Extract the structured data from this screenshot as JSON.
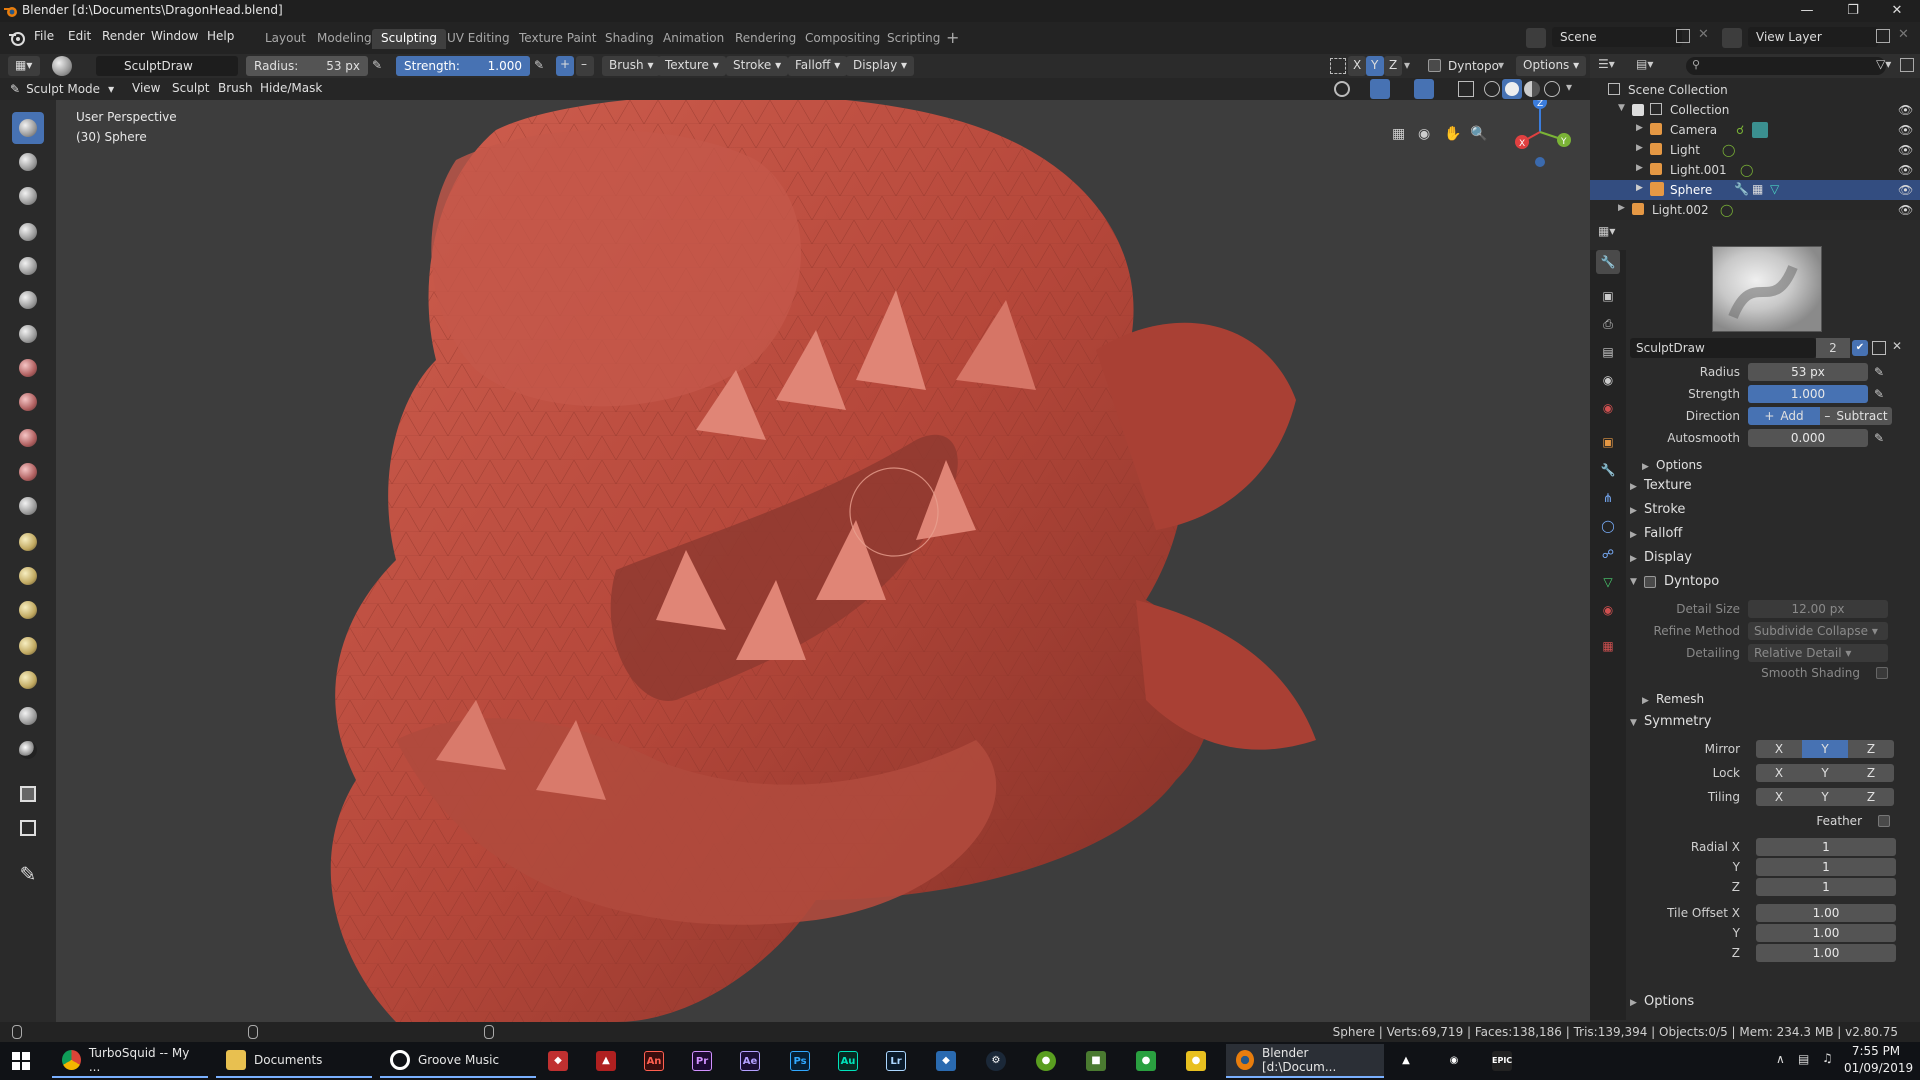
{
  "window": {
    "title": "Blender [d:\\Documents\\DragonHead.blend]"
  },
  "menu": [
    "File",
    "Edit",
    "Render",
    "Window",
    "Help"
  ],
  "workspaces": [
    "Layout",
    "Modeling",
    "Sculpting",
    "UV Editing",
    "Texture Paint",
    "Shading",
    "Animation",
    "Rendering",
    "Compositing",
    "Scripting"
  ],
  "active_workspace": "Sculpting",
  "top_right": {
    "scene": "Scene",
    "view_layer": "View Layer"
  },
  "tool_header": {
    "brush_name": "SculptDraw",
    "radius_label": "Radius:",
    "radius_value": "53 px",
    "strength_label": "Strength:",
    "strength_value": "1.000",
    "strength_fill": 1.0,
    "menus": [
      "Brush",
      "Texture",
      "Stroke",
      "Falloff",
      "Display"
    ],
    "axes": [
      "X",
      "Y",
      "Z"
    ],
    "dyntopo": "Dyntopo",
    "options": "Options"
  },
  "mode_header": {
    "mode": "Sculpt Mode",
    "menus": [
      "View",
      "Sculpt",
      "Brush",
      "Hide/Mask"
    ]
  },
  "viewport": {
    "perspective": "User Perspective",
    "object": "(30) Sphere",
    "gizmo": {
      "x": "X",
      "y": "Y",
      "z": "Z"
    }
  },
  "outliner": {
    "root": "Scene Collection",
    "items": [
      {
        "name": "Collection",
        "indent": 1
      },
      {
        "name": "Camera",
        "indent": 2
      },
      {
        "name": "Light",
        "indent": 2
      },
      {
        "name": "Light.001",
        "indent": 2
      },
      {
        "name": "Sphere",
        "indent": 2,
        "selected": true
      },
      {
        "name": "Light.002",
        "indent": 1
      }
    ]
  },
  "properties": {
    "brush_name": "SculptDraw",
    "brush_users": "2",
    "radius": {
      "label": "Radius",
      "value": "53 px"
    },
    "strength": {
      "label": "Strength",
      "value": "1.000"
    },
    "direction": {
      "label": "Direction",
      "add": "Add",
      "subtract": "Subtract"
    },
    "autosmooth": {
      "label": "Autosmooth",
      "value": "0.000"
    },
    "options_sub": "Options",
    "sections": [
      "Texture",
      "Stroke",
      "Falloff",
      "Display"
    ],
    "dyntopo": {
      "label": "Dyntopo",
      "detail_size": {
        "label": "Detail Size",
        "value": "12.00 px"
      },
      "refine_method": {
        "label": "Refine Method",
        "value": "Subdivide Collapse"
      },
      "detailing": {
        "label": "Detailing",
        "value": "Relative Detail"
      },
      "smooth_shading": "Smooth Shading"
    },
    "remesh": "Remesh",
    "symmetry": {
      "label": "Symmetry",
      "mirror": "Mirror",
      "lock": "Lock",
      "tiling": "Tiling",
      "axes": [
        "X",
        "Y",
        "Z"
      ],
      "feather": "Feather",
      "radial_x": {
        "label": "Radial X",
        "value": "1"
      },
      "radial_y": {
        "label": "Y",
        "value": "1"
      },
      "radial_z": {
        "label": "Z",
        "value": "1"
      },
      "tile_x": {
        "label": "Tile Offset X",
        "value": "1.00"
      },
      "tile_y": {
        "label": "Y",
        "value": "1.00"
      },
      "tile_z": {
        "label": "Z",
        "value": "1.00"
      }
    },
    "options_bottom": "Options"
  },
  "status": "Sphere | Verts:69,719 | Faces:138,186 | Tris:139,394 | Objects:0/5 | Mem: 234.3 MB | v2.80.75",
  "taskbar": {
    "chrome": "TurboSquid -- My ...",
    "documents": "Documents",
    "groove": "Groove Music",
    "blender": "Blender [d:\\Docum...",
    "apps": [
      "An",
      "Pr",
      "Ae",
      "Ps",
      "Au",
      "Lr"
    ],
    "time": "7:55 PM",
    "date": "01/09/2019",
    "epic": "EPIC"
  },
  "colors": {
    "accent": "#4772b3",
    "selection": "#334d80",
    "mesh": "#b5473a",
    "background": "#3d3d3d"
  }
}
